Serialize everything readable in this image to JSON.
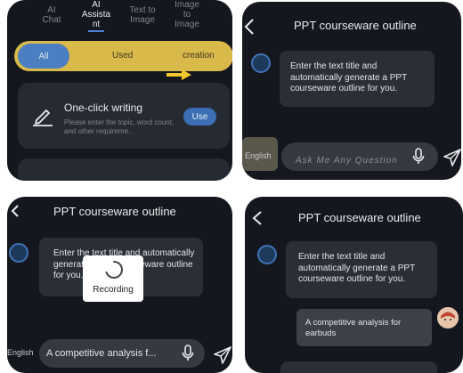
{
  "panel1": {
    "top_tabs": [
      {
        "label": "AI\nChat"
      },
      {
        "label": "AI\nAssista\nnt"
      },
      {
        "label": "Text to\nImage"
      },
      {
        "label": "Image\nto\nImage"
      }
    ],
    "segments": {
      "all": "All",
      "used": "Used",
      "creation": "creation"
    },
    "card": {
      "title": "One-click writing",
      "description": "Please enter the topic, word count, and other requireme...",
      "use_label": "Use"
    }
  },
  "panel2": {
    "title": "PPT courseware outline",
    "bot_message": "Enter the text title and automatically generate a PPT courseware outline for you.",
    "language": "English",
    "input_placeholder": "Ask Me Any Question"
  },
  "panel3": {
    "title": "PPT courseware outline",
    "bot_message": "Enter the text title and automatically generate a PPT courseware outline for you.",
    "recording_label": "Recording",
    "language": "English",
    "input_value": "A competitive analysis f..."
  },
  "panel4": {
    "title": "PPT courseware outline",
    "bot_message": "Enter the text title and automatically generate a PPT courseware outline for you.",
    "user_message": "A competitive analysis for earbuds"
  },
  "colors": {
    "panel_bg": "#14171d",
    "accent_blue": "#3c6fb3",
    "segment_yellow": "#d9b94a",
    "arrow_yellow": "#f2c72b"
  },
  "icons": [
    "pen-icon",
    "back-chevron-icon",
    "bot-icon",
    "mic-icon",
    "send-icon",
    "loading-spinner-icon",
    "user-avatar"
  ]
}
